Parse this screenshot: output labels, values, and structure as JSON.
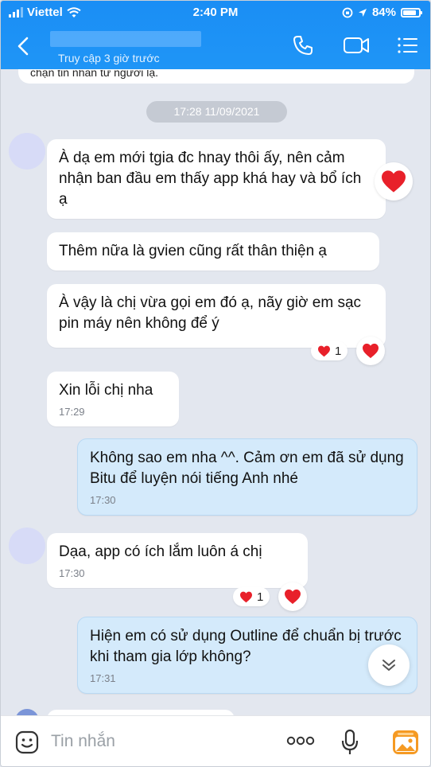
{
  "status_bar": {
    "carrier": "Viettel",
    "time": "2:40 PM",
    "battery": "84%"
  },
  "header": {
    "last_seen": "Truy cập 3 giờ trước"
  },
  "previous_message_fragment": "chặn tin nhắn từ người lạ.",
  "date_separator": "17:28 11/09/2021",
  "messages": [
    {
      "text": "À dạ em mới tgia đc hnay thôi ấy, nên cảm nhận ban đầu em thấy app khá hay và bổ ích ạ"
    },
    {
      "text": "Thêm nữa là gvien cũng rất thân thiện ạ"
    },
    {
      "text": "À vậy là chị vừa gọi em đó ạ, nãy giờ em sạc pin máy nên không để ý",
      "reaction_count": "1"
    },
    {
      "text": "Xin lỗi chị nha",
      "time": "17:29"
    },
    {
      "text": "Không sao em nha ^^. Cảm ơn em đã sử dụng Bitu để luyện nói tiếng Anh nhé",
      "time": "17:30"
    },
    {
      "text": "Dạa, app có ích lắm luôn á chị",
      "time": "17:30",
      "reaction_count": "1"
    },
    {
      "text": "Hiện em có sử dụng Outline để chuẩn bị trước khi tham gia lớp không?",
      "time": "17:31"
    }
  ],
  "input": {
    "placeholder": "Tin nhắn"
  },
  "icons": {
    "back": "chevron-left-icon",
    "call": "phone-icon",
    "video": "video-camera-icon",
    "menu": "list-menu-icon",
    "reaction": "heart-icon",
    "scroll": "chevron-double-down-icon",
    "sticker": "sticker-smile-icon",
    "more": "more-dots-icon",
    "mic": "microphone-icon",
    "gallery": "gallery-image-icon"
  },
  "colors": {
    "header": "#1a8ef5",
    "mine_bubble": "#d4eafb",
    "heart": "#e8202a",
    "gallery": "#f59a23"
  }
}
